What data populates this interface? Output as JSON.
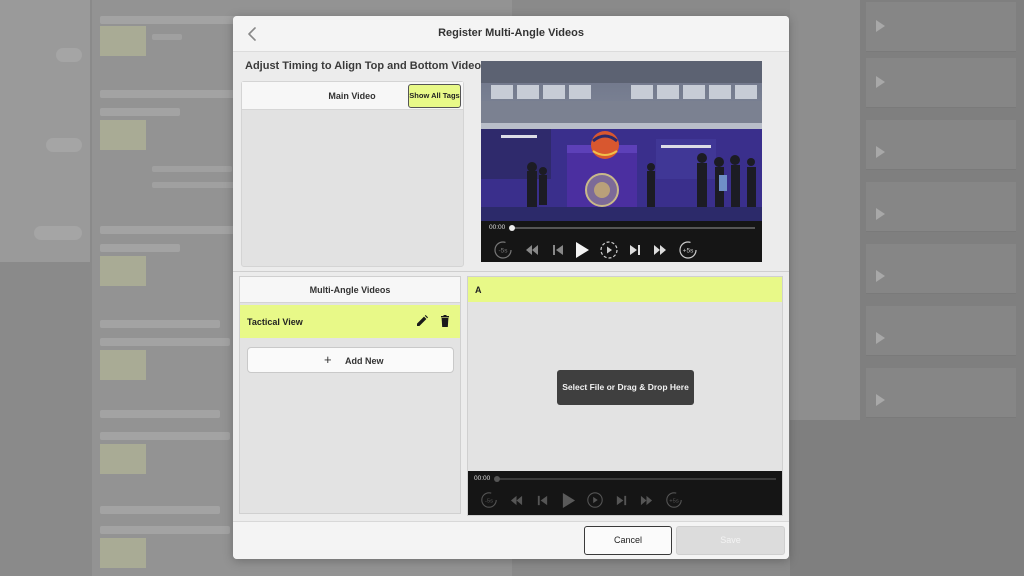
{
  "modal": {
    "title": "Register Multi-Angle Videos",
    "instruction": "Adjust Timing to Align Top and Bottom Videos."
  },
  "main_video": {
    "label": "Main Video",
    "show_tags_label": "Show All Tags",
    "player": {
      "current_time": "00:00",
      "progress": 0.0,
      "controls": [
        "replay-5-icon",
        "rewind-icon",
        "frame-back-icon",
        "play-icon",
        "slow-play-icon",
        "frame-forward-icon",
        "fast-forward-icon",
        "forward-5-icon"
      ]
    }
  },
  "multi_angle": {
    "title": "Multi-Angle Videos",
    "items": [
      {
        "name": "Tactical View",
        "selected": true
      }
    ],
    "add_new_label": "Add New"
  },
  "angle_video": {
    "letter": "A",
    "drop_label": "Select File or Drag & Drop Here",
    "player": {
      "current_time": "00:00",
      "progress": 0.0
    }
  },
  "footer": {
    "cancel_label": "Cancel",
    "save_label": "Save",
    "save_enabled": false
  },
  "colors": {
    "accent": "#e8f988",
    "modal_bg": "#ececec",
    "overlay": "#8a8a8a",
    "player_bg": "#151515"
  }
}
